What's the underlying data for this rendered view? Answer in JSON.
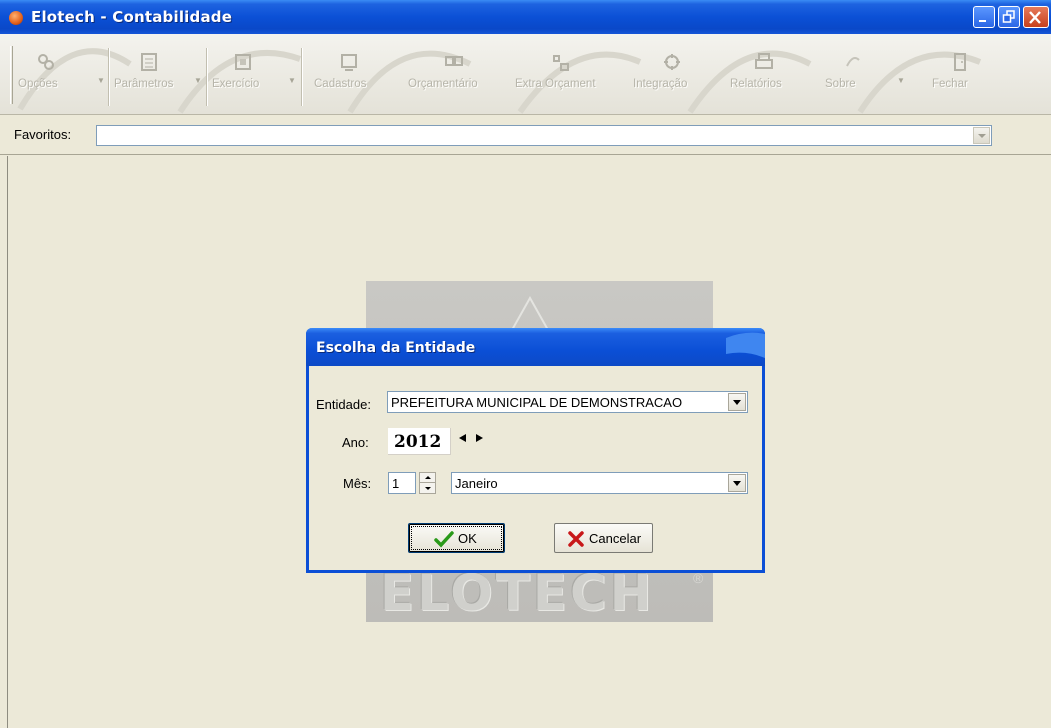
{
  "window": {
    "title": "Elotech - Contabilidade"
  },
  "toolbar": {
    "items": [
      {
        "label": "Opções",
        "icon": "options-icon"
      },
      {
        "label": "Parâmetros",
        "icon": "parameters-icon"
      },
      {
        "label": "Exercício",
        "icon": "exercise-icon"
      },
      {
        "label": "Cadastros",
        "icon": "registry-icon"
      },
      {
        "label": "Orçamentário",
        "icon": "budget-icon"
      },
      {
        "label": "Extra Orçament",
        "icon": "extra-budget-icon"
      },
      {
        "label": "Integração",
        "icon": "integration-icon"
      },
      {
        "label": "Relatórios",
        "icon": "printer-icon"
      },
      {
        "label": "Sobre",
        "icon": "about-icon"
      },
      {
        "label": "Fechar",
        "icon": "exit-door-icon"
      }
    ]
  },
  "favorites": {
    "label": "Favoritos:",
    "value": ""
  },
  "background_logo": {
    "text": "ELOTECH",
    "registered": "®"
  },
  "dialog": {
    "title": "Escolha da Entidade",
    "entity_label": "Entidade:",
    "entity_value": "PREFEITURA MUNICIPAL DE DEMONSTRACAO",
    "year_label": "Ano:",
    "year_value": "2012",
    "month_label": "Mês:",
    "month_number": "1",
    "month_name": "Janeiro",
    "ok_label": "OK",
    "cancel_label": "Cancelar"
  },
  "colors": {
    "title_blue": "#0b50d6",
    "face": "#ece9d8",
    "toolbar_label_disabled": "#b7b5aa"
  }
}
